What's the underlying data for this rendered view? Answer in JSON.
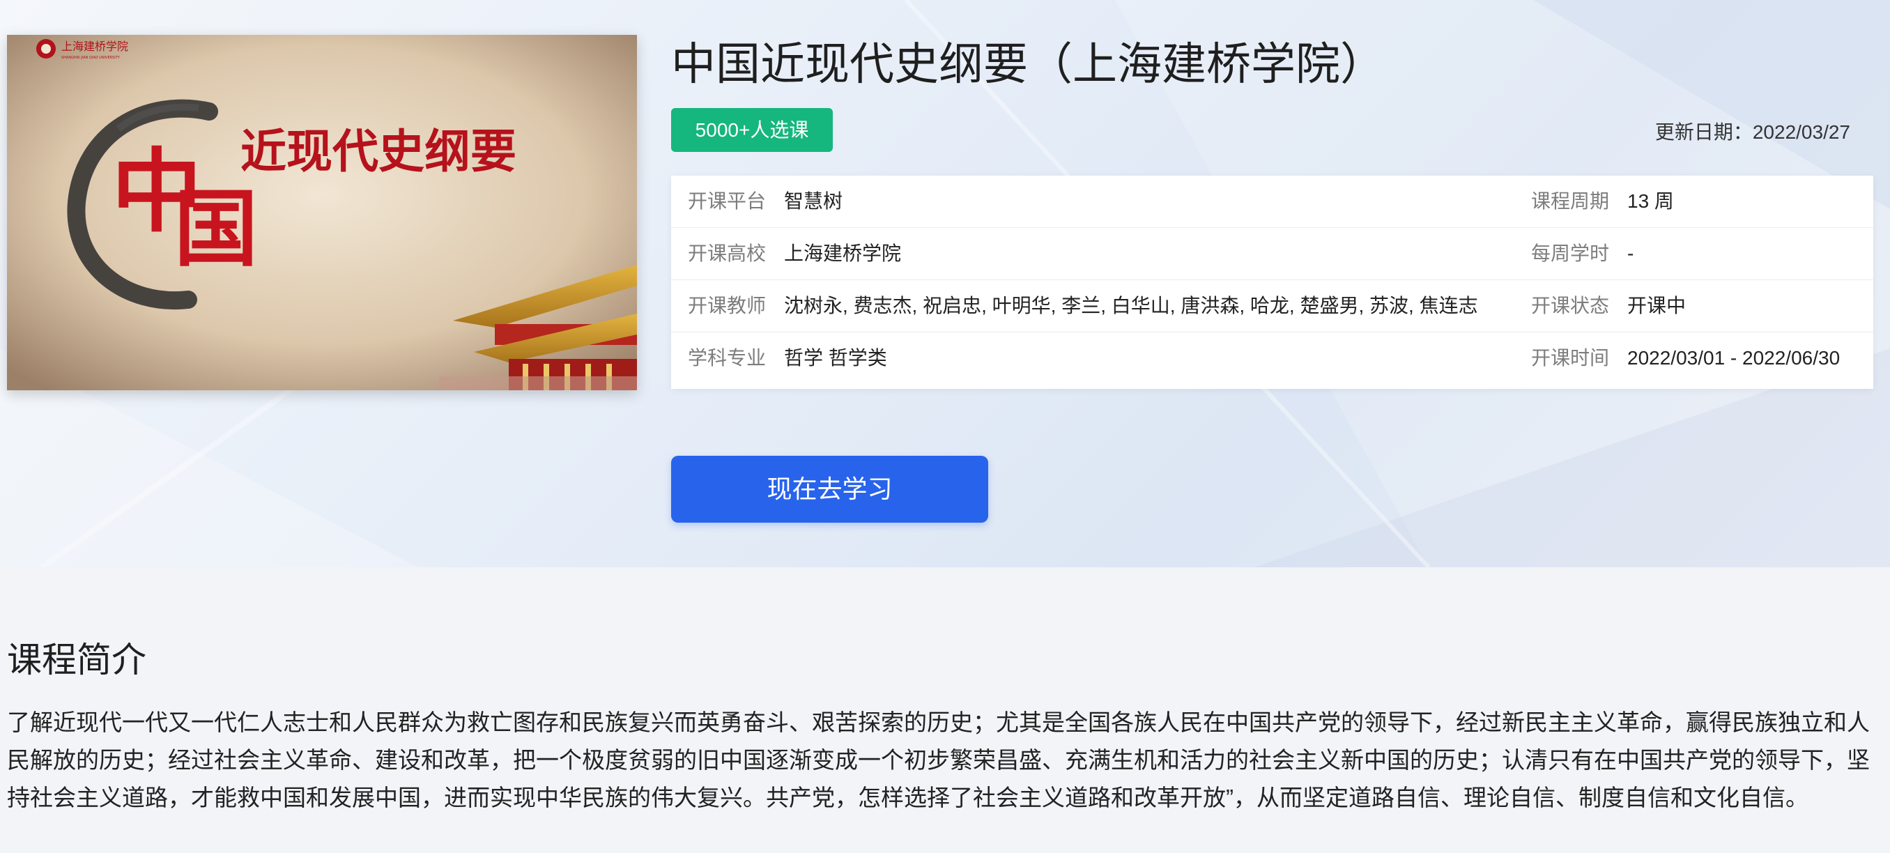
{
  "course": {
    "title": "中国近现代史纲要（上海建桥学院）",
    "enroll_badge": "5000+人选课",
    "update_label": "更新日期：",
    "update_date": "2022/03/27",
    "cover": {
      "university_logo_text": "上海建桥学院",
      "university_logo_subtext": "SHANGHAI JIAN QIAO UNIVERSITY",
      "big_char_1": "中",
      "big_char_2": "国",
      "title_text": "近现代史纲要"
    }
  },
  "info": {
    "rows": [
      {
        "left_label": "开课平台",
        "left_value": "智慧树",
        "right_label": "课程周期",
        "right_value": "13 周"
      },
      {
        "left_label": "开课高校",
        "left_value": "上海建桥学院",
        "right_label": "每周学时",
        "right_value": "-"
      },
      {
        "left_label": "开课教师",
        "left_value": "沈树永, 费志杰, 祝启忠, 叶明华, 李兰, 白华山, 唐洪森, 哈龙, 楚盛男, 苏波, 焦连志",
        "right_label": "开课状态",
        "right_value": "开课中"
      },
      {
        "left_label": "学科专业",
        "left_value": "哲学 哲学类",
        "right_label": "开课时间",
        "right_value": "2022/03/01 - 2022/06/30"
      }
    ]
  },
  "cta": {
    "label": "现在去学习"
  },
  "intro": {
    "heading": "课程简介",
    "text": "了解近现代一代又一代仁人志士和人民群众为救亡图存和民族复兴而英勇奋斗、艰苦探索的历史；尤其是全国各族人民在中国共产党的领导下，经过新民主主义革命，赢得民族独立和人民解放的历史；经过社会主义革命、建设和改革，把一个极度贫弱的旧中国逐渐变成一个初步繁荣昌盛、充满生机和活力的社会主义新中国的历史；认清只有在中国共产党的领导下，坚持社会主义道路，才能救中国和发展中国，进而实现中华民族的伟大复兴。共产党，怎样选择了社会主义道路和改革开放”，从而坚定道路自信、理论自信、制度自信和文化自信。"
  },
  "colors": {
    "badge": "#16b67f",
    "cta": "#2863eb",
    "cover_red": "#c8141e"
  }
}
